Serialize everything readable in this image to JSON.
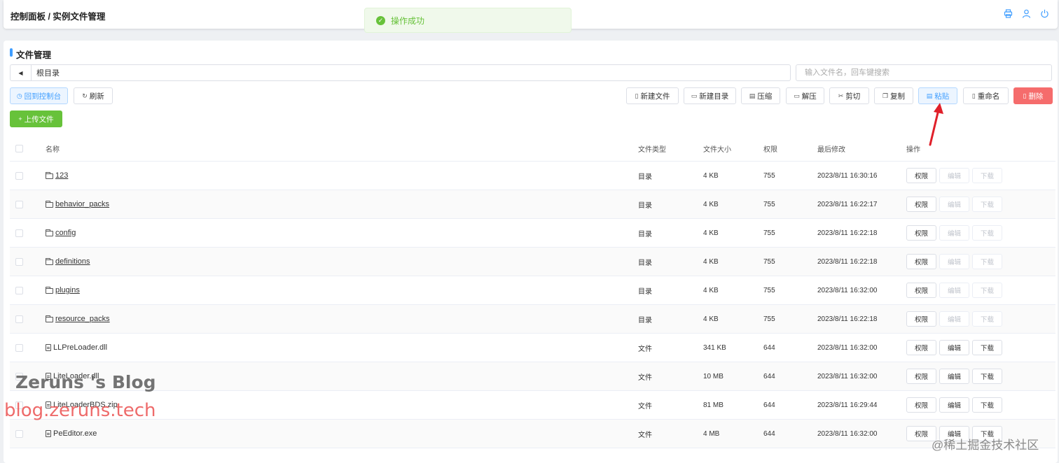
{
  "header": {
    "breadcrumb": "控制面板 / 实例文件管理"
  },
  "toast": {
    "message": "操作成功"
  },
  "section": {
    "title": "文件管理"
  },
  "pathbar": {
    "path": "根目录"
  },
  "search": {
    "placeholder": "输入文件名，回车键搜索"
  },
  "toolbar": {
    "back_console": "回到控制台",
    "refresh": "刷新",
    "new_file": "新建文件",
    "new_dir": "新建目录",
    "compress": "压缩",
    "decompress": "解压",
    "cut": "剪切",
    "copy": "复制",
    "paste": "粘贴",
    "rename": "重命名",
    "delete": "删除",
    "upload": "上传文件"
  },
  "table": {
    "headers": {
      "name": "名称",
      "type": "文件类型",
      "size": "文件大小",
      "perm": "权限",
      "modified": "最后修改",
      "ops": "操作"
    },
    "op_labels": {
      "perm": "权限",
      "edit": "编辑",
      "download": "下载"
    },
    "rows": [
      {
        "name": "123",
        "kind": "folder",
        "type": "目录",
        "size": "4 KB",
        "perm": "755",
        "modified": "2023/8/11 16:30:16"
      },
      {
        "name": "behavior_packs",
        "kind": "folder",
        "type": "目录",
        "size": "4 KB",
        "perm": "755",
        "modified": "2023/8/11 16:22:17"
      },
      {
        "name": "config",
        "kind": "folder",
        "type": "目录",
        "size": "4 KB",
        "perm": "755",
        "modified": "2023/8/11 16:22:18"
      },
      {
        "name": "definitions",
        "kind": "folder",
        "type": "目录",
        "size": "4 KB",
        "perm": "755",
        "modified": "2023/8/11 16:22:18"
      },
      {
        "name": "plugins",
        "kind": "folder",
        "type": "目录",
        "size": "4 KB",
        "perm": "755",
        "modified": "2023/8/11 16:32:00"
      },
      {
        "name": "resource_packs",
        "kind": "folder",
        "type": "目录",
        "size": "4 KB",
        "perm": "755",
        "modified": "2023/8/11 16:22:18"
      },
      {
        "name": "LLPreLoader.dll",
        "kind": "file",
        "type": "文件",
        "size": "341 KB",
        "perm": "644",
        "modified": "2023/8/11 16:32:00"
      },
      {
        "name": "LiteLoader.dll",
        "kind": "file",
        "type": "文件",
        "size": "10 MB",
        "perm": "644",
        "modified": "2023/8/11 16:32:00"
      },
      {
        "name": "LiteLoaderBDS.zip",
        "kind": "file",
        "type": "文件",
        "size": "81 MB",
        "perm": "644",
        "modified": "2023/8/11 16:29:44"
      },
      {
        "name": "PeEditor.exe",
        "kind": "file",
        "type": "文件",
        "size": "4 MB",
        "perm": "644",
        "modified": "2023/8/11 16:32:00"
      }
    ]
  },
  "watermarks": {
    "blog_name": "Zeruns 's Blog",
    "blog_url": "blog.zeruns.tech",
    "community": "@稀土掘金技术社区"
  },
  "colors": {
    "primary": "#409eff",
    "success": "#67c23a",
    "danger": "#f56c6c",
    "arrow": "#e0202a"
  }
}
